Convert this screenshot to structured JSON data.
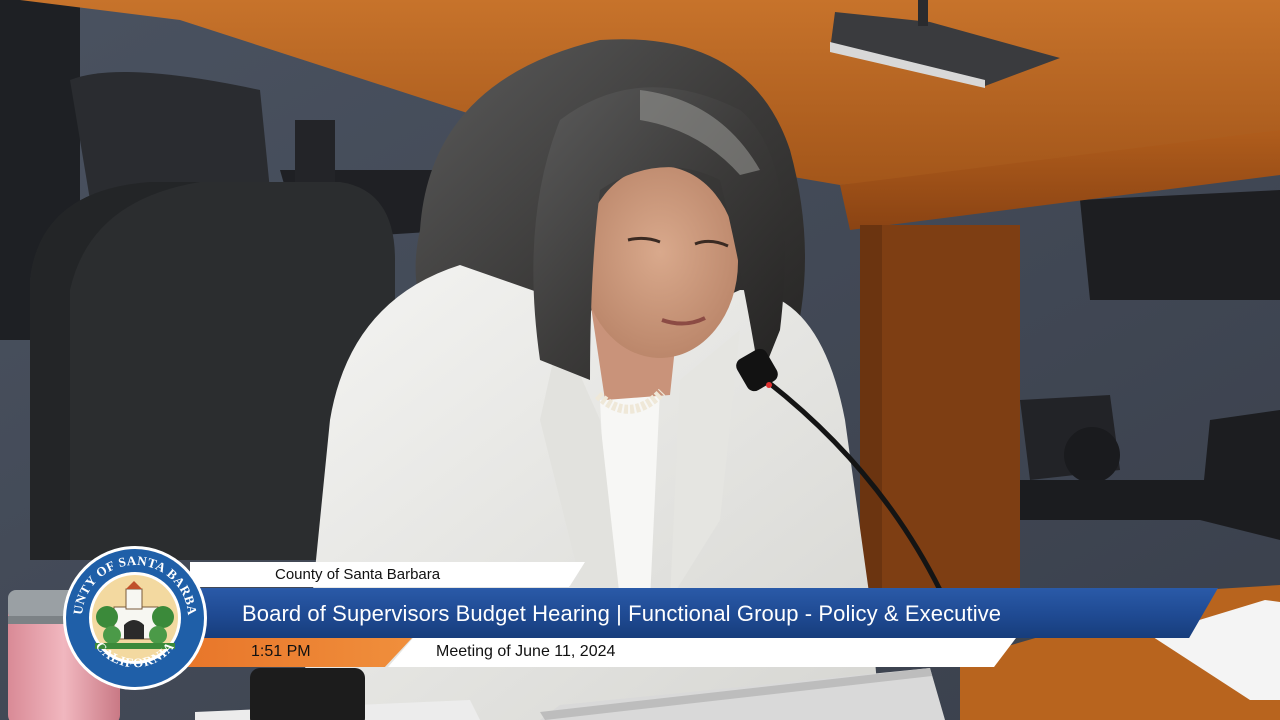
{
  "overlay": {
    "organization": "County of Santa Barbara",
    "title": "Board of Supervisors Budget Hearing | Functional Group - Policy & Executive",
    "time": "1:51 PM",
    "meeting": "Meeting of June 11, 2024"
  },
  "seal": {
    "top_text": "COUNTY OF SANTA BARBARA",
    "bottom_text": "CALIFORNIA"
  },
  "colors": {
    "title_bar": "#1f4a92",
    "time_box": "#e8762a",
    "desk_wood": "#b8641e",
    "seal_ring": "#1f5fa8"
  }
}
